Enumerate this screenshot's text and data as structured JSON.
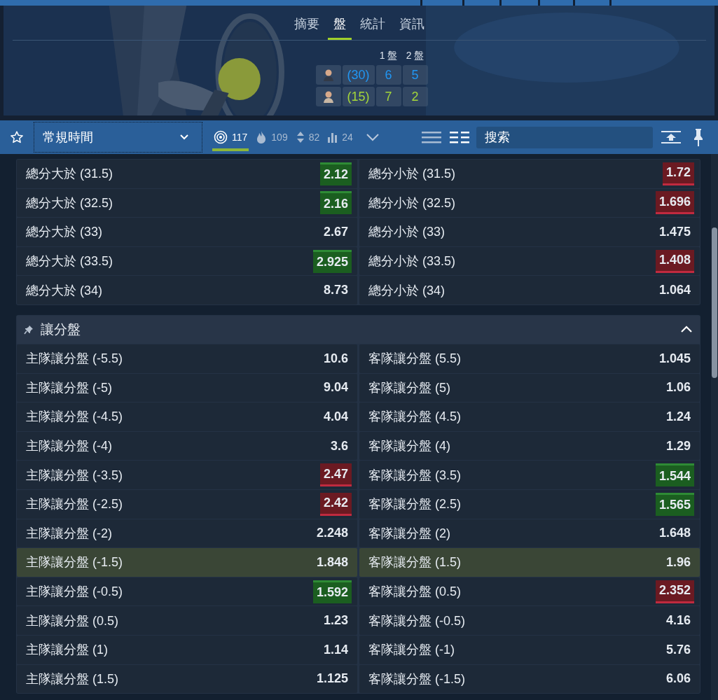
{
  "header": {
    "tabs": [
      {
        "label": "摘要",
        "selected": false
      },
      {
        "label": "盤",
        "selected": true
      },
      {
        "label": "統計",
        "selected": false
      },
      {
        "label": "資訊",
        "selected": false
      }
    ],
    "score": {
      "columns": [
        "1 盤",
        "2 盤"
      ],
      "players": [
        {
          "points": "(30)",
          "sets": [
            "6",
            "5"
          ],
          "color": "#2196f3"
        },
        {
          "points": "(15)",
          "sets": [
            "7",
            "2"
          ],
          "color": "#a4d63a"
        }
      ]
    }
  },
  "toolbar": {
    "period": "常規時間",
    "filters": [
      {
        "kind": "target",
        "count": "117",
        "selected": true
      },
      {
        "kind": "flame",
        "count": "109",
        "selected": false
      },
      {
        "kind": "updown",
        "count": "82",
        "selected": false
      },
      {
        "kind": "bars",
        "count": "24",
        "selected": false
      }
    ],
    "views": [
      {
        "kind": "list",
        "selected": false
      },
      {
        "kind": "columns",
        "selected": true
      }
    ],
    "search": {
      "placeholder": "搜索"
    }
  },
  "sections": [
    {
      "rows": [
        {
          "highlighted": false,
          "home": {
            "label": "總分大於 (31.5)",
            "odds": "2.12",
            "rising": true,
            "falling": false
          },
          "away": {
            "label": "總分小於 (31.5)",
            "odds": "1.72",
            "rising": false,
            "falling": true
          }
        },
        {
          "highlighted": false,
          "home": {
            "label": "總分大於 (32.5)",
            "odds": "2.16",
            "rising": true,
            "falling": false
          },
          "away": {
            "label": "總分小於 (32.5)",
            "odds": "1.696",
            "rising": false,
            "falling": true
          }
        },
        {
          "highlighted": false,
          "home": {
            "label": "總分大於 (33)",
            "odds": "2.67",
            "rising": false,
            "falling": false
          },
          "away": {
            "label": "總分小於 (33)",
            "odds": "1.475",
            "rising": false,
            "falling": false
          }
        },
        {
          "highlighted": false,
          "home": {
            "label": "總分大於 (33.5)",
            "odds": "2.925",
            "rising": true,
            "falling": false
          },
          "away": {
            "label": "總分小於 (33.5)",
            "odds": "1.408",
            "rising": false,
            "falling": true
          }
        },
        {
          "highlighted": false,
          "home": {
            "label": "總分大於 (34)",
            "odds": "8.73",
            "rising": false,
            "falling": false
          },
          "away": {
            "label": "總分小於 (34)",
            "odds": "1.064",
            "rising": false,
            "falling": false
          }
        }
      ]
    },
    {
      "title": "讓分盤",
      "pinned": true,
      "expanded": true,
      "rows": [
        {
          "highlighted": false,
          "home": {
            "label": "主隊讓分盤 (-5.5)",
            "odds": "10.6",
            "rising": false,
            "falling": false
          },
          "away": {
            "label": "客隊讓分盤 (5.5)",
            "odds": "1.045",
            "rising": false,
            "falling": false
          }
        },
        {
          "highlighted": false,
          "home": {
            "label": "主隊讓分盤 (-5)",
            "odds": "9.04",
            "rising": false,
            "falling": false
          },
          "away": {
            "label": "客隊讓分盤 (5)",
            "odds": "1.06",
            "rising": false,
            "falling": false
          }
        },
        {
          "highlighted": false,
          "home": {
            "label": "主隊讓分盤 (-4.5)",
            "odds": "4.04",
            "rising": false,
            "falling": false
          },
          "away": {
            "label": "客隊讓分盤 (4.5)",
            "odds": "1.24",
            "rising": false,
            "falling": false
          }
        },
        {
          "highlighted": false,
          "home": {
            "label": "主隊讓分盤 (-4)",
            "odds": "3.6",
            "rising": false,
            "falling": false
          },
          "away": {
            "label": "客隊讓分盤 (4)",
            "odds": "1.29",
            "rising": false,
            "falling": false
          }
        },
        {
          "highlighted": false,
          "home": {
            "label": "主隊讓分盤 (-3.5)",
            "odds": "2.47",
            "rising": false,
            "falling": true
          },
          "away": {
            "label": "客隊讓分盤 (3.5)",
            "odds": "1.544",
            "rising": true,
            "falling": false
          }
        },
        {
          "highlighted": false,
          "home": {
            "label": "主隊讓分盤 (-2.5)",
            "odds": "2.42",
            "rising": false,
            "falling": true
          },
          "away": {
            "label": "客隊讓分盤 (2.5)",
            "odds": "1.565",
            "rising": true,
            "falling": false
          }
        },
        {
          "highlighted": false,
          "home": {
            "label": "主隊讓分盤 (-2)",
            "odds": "2.248",
            "rising": false,
            "falling": false
          },
          "away": {
            "label": "客隊讓分盤 (2)",
            "odds": "1.648",
            "rising": false,
            "falling": false
          }
        },
        {
          "highlighted": true,
          "home": {
            "label": "主隊讓分盤 (-1.5)",
            "odds": "1.848",
            "rising": false,
            "falling": false
          },
          "away": {
            "label": "客隊讓分盤 (1.5)",
            "odds": "1.96",
            "rising": false,
            "falling": false
          }
        },
        {
          "highlighted": false,
          "home": {
            "label": "主隊讓分盤 (-0.5)",
            "odds": "1.592",
            "rising": true,
            "falling": false
          },
          "away": {
            "label": "客隊讓分盤 (0.5)",
            "odds": "2.352",
            "rising": false,
            "falling": true
          }
        },
        {
          "highlighted": false,
          "home": {
            "label": "主隊讓分盤 (0.5)",
            "odds": "1.23",
            "rising": false,
            "falling": false
          },
          "away": {
            "label": "客隊讓分盤 (-0.5)",
            "odds": "4.16",
            "rising": false,
            "falling": false
          }
        },
        {
          "highlighted": false,
          "home": {
            "label": "主隊讓分盤 (1)",
            "odds": "1.14",
            "rising": false,
            "falling": false
          },
          "away": {
            "label": "客隊讓分盤 (-1)",
            "odds": "5.76",
            "rising": false,
            "falling": false
          }
        },
        {
          "highlighted": false,
          "home": {
            "label": "主隊讓分盤 (1.5)",
            "odds": "1.125",
            "rising": false,
            "falling": false
          },
          "away": {
            "label": "客隊讓分盤 (-1.5)",
            "odds": "6.06",
            "rising": false,
            "falling": false
          }
        }
      ]
    }
  ]
}
